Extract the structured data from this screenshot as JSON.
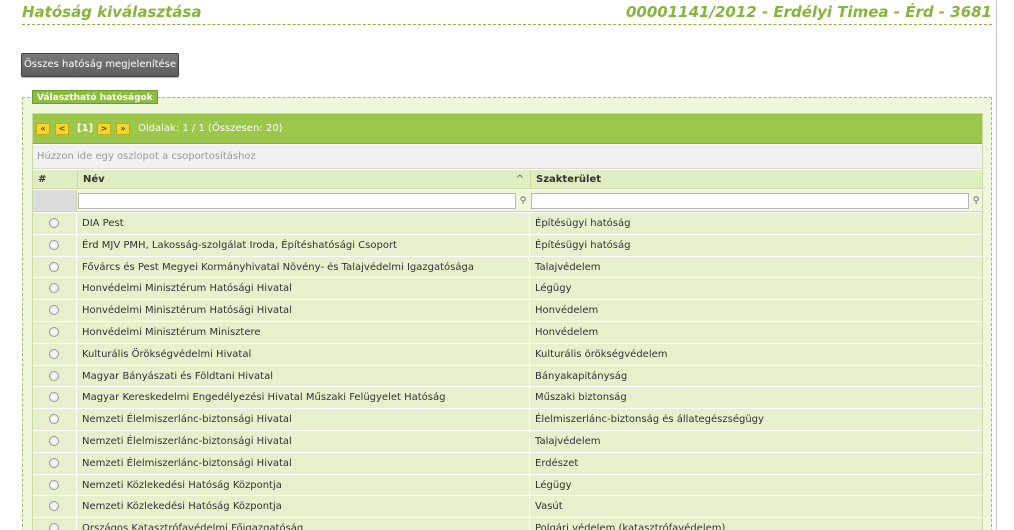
{
  "header": {
    "title": "Hatóság kiválasztása",
    "case_info": "00001141/2012 - Erdélyi Timea - Érd - 3681"
  },
  "toolbar": {
    "show_all_label": "Összes hatóság megjelenítése"
  },
  "panel": {
    "legend": "Választható hatóságok"
  },
  "pager": {
    "first": "«",
    "prev": "<",
    "current": "[1]",
    "next": ">",
    "last": "»",
    "info": "Oldalak: 1 / 1 (Összesen: 20)"
  },
  "group_hint": "Húzzon ide egy oszlopot a csoportosításhoz",
  "columns": {
    "hash": "#",
    "name": "Név",
    "area": "Szakterület",
    "sort_indicator": "^"
  },
  "rows": [
    {
      "name": "DIA Pest",
      "area": "Építésügyi hatóság"
    },
    {
      "name": "Érd MJV PMH, Lakosság-szolgálat Iroda, Építéshatósági Csoport",
      "area": "Építésügyi hatóság"
    },
    {
      "name": "Fővárcs és Pest Megyei Kormányhivatal Növény- és Talajvédelmi Igazgatósága",
      "area": "Talajvédelem"
    },
    {
      "name": "Honvédelmi Minisztérum Hatósági Hivatal",
      "area": "Légügy"
    },
    {
      "name": "Honvédelmi Minisztérum Hatósági Hivatal",
      "area": "Honvédelem"
    },
    {
      "name": "Honvédelmi Minisztérum Minisztere",
      "area": "Honvédelem"
    },
    {
      "name": "Kulturális Örökségvédelmi Hivatal",
      "area": "Kulturális örökségvédelem"
    },
    {
      "name": "Magyar Bányászati és Földtani Hivatal",
      "area": "Bányakapitányság"
    },
    {
      "name": "Magyar Kereskedelmi Engedélyezési Hivatal Műszaki Felügyelet Hatóság",
      "area": "Műszaki biztonság"
    },
    {
      "name": "Nemzeti Élelmiszerlánc-biztonsági Hivatal",
      "area": "Élelmiszerlánc-biztonság és állategészségügy"
    },
    {
      "name": "Nemzeti Élelmiszerlánc-biztonsági Hivatal",
      "area": "Talajvédelem"
    },
    {
      "name": "Nemzeti Élelmiszerlánc-biztonsági Hivatal",
      "area": "Erdészet"
    },
    {
      "name": "Nemzeti Közlekedési Hatóság Központja",
      "area": "Légügy"
    },
    {
      "name": "Nemzeti Közlekedési Hatóság Központja",
      "area": "Vasút"
    },
    {
      "name": "Országos Katasztrófavédelmi Főigazgatóság",
      "area": "Polgári védelem (katasztrófavédelem)"
    }
  ]
}
